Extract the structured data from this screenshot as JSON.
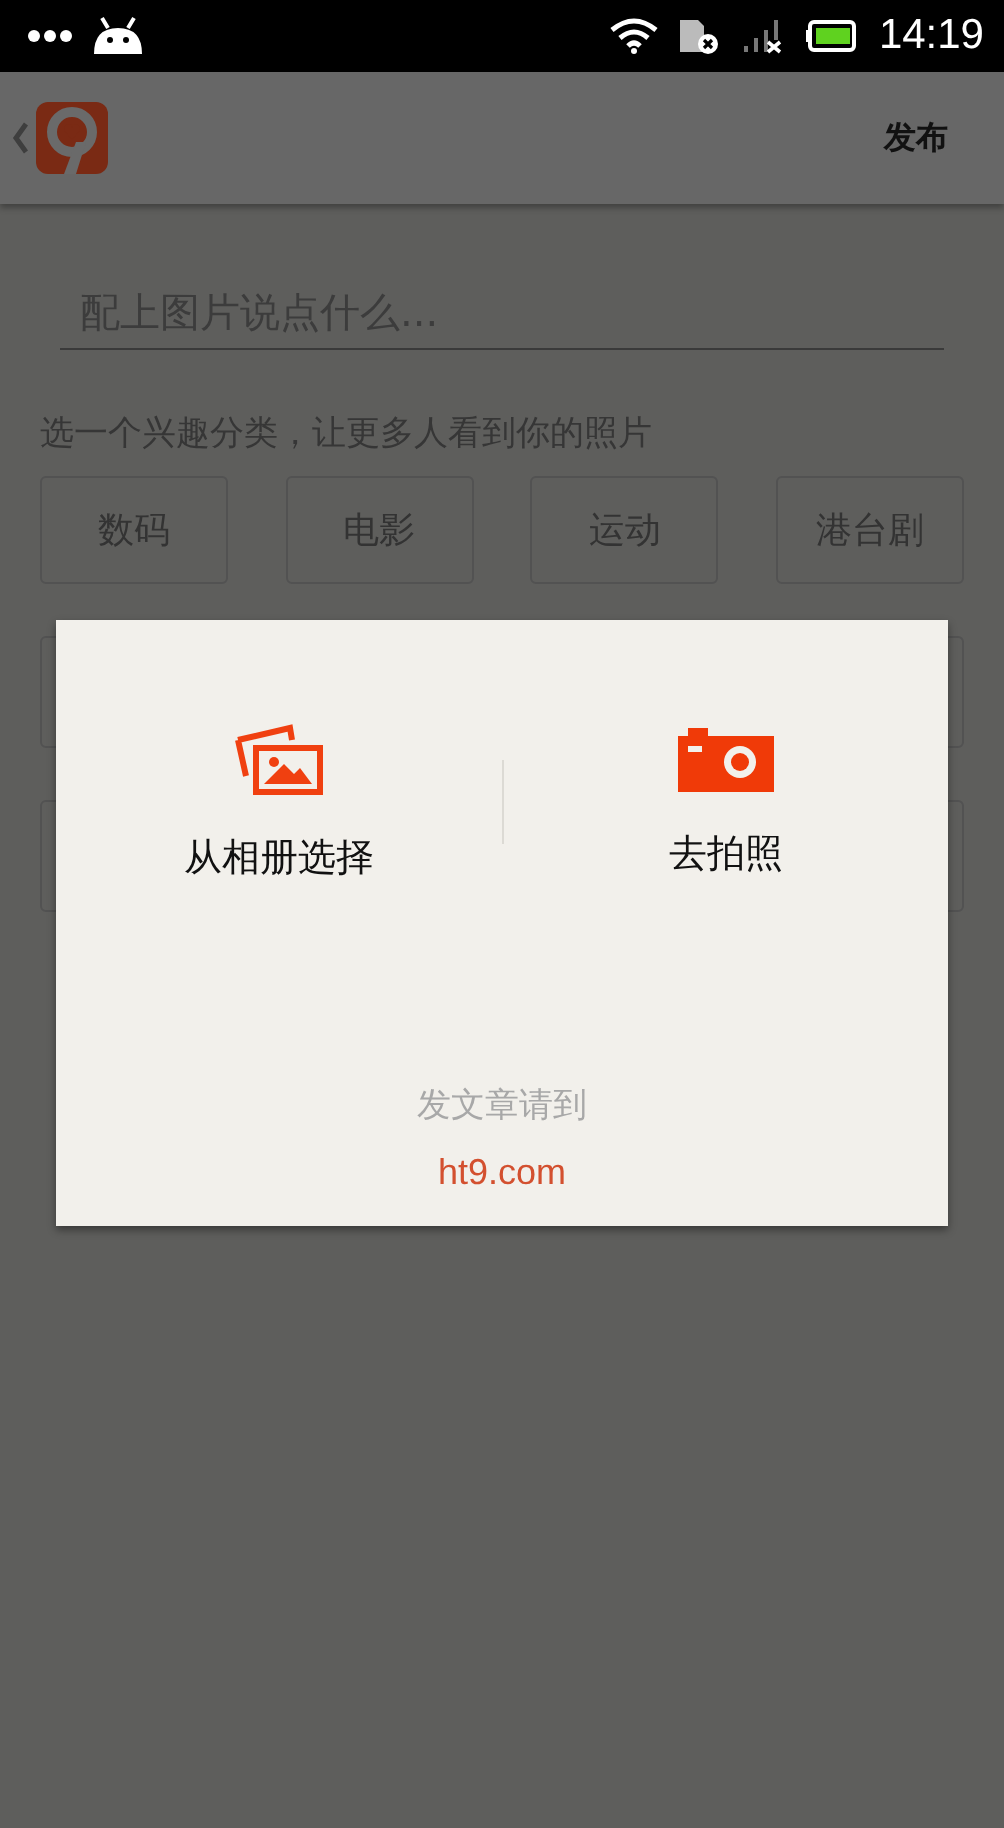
{
  "status_bar": {
    "time": "14:19"
  },
  "app_bar": {
    "action": "发布"
  },
  "caption_field": {
    "placeholder": "配上图片说点什么..."
  },
  "category_hint": "选一个兴趣分类，让更多人看到你的照片",
  "categories": [
    {
      "label": "数码",
      "selected": false
    },
    {
      "label": "电影",
      "selected": false
    },
    {
      "label": "运动",
      "selected": false
    },
    {
      "label": "港台剧",
      "selected": false
    }
  ],
  "dialog": {
    "options": [
      {
        "kind": "album",
        "label": "从相册选择"
      },
      {
        "kind": "camera",
        "label": "去拍照"
      }
    ],
    "footer_text": "发文章请到",
    "footer_link": "ht9.com"
  }
}
